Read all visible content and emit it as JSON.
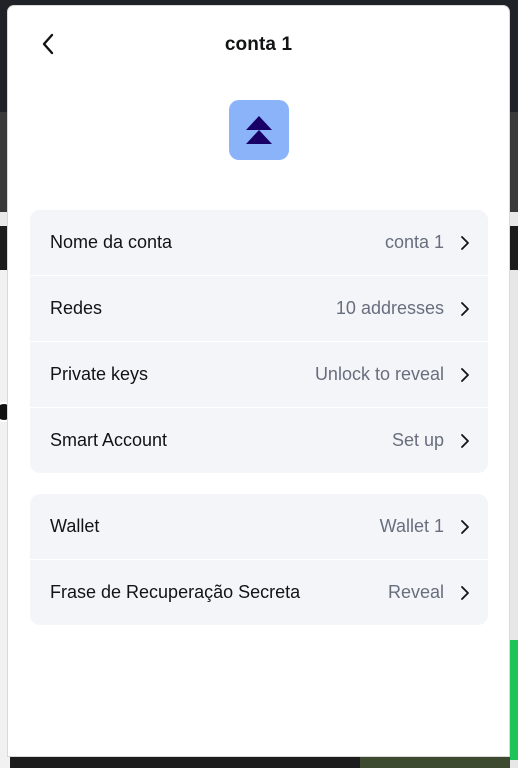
{
  "header": {
    "title": "conta 1",
    "back_icon": "chevron-left-icon"
  },
  "avatar": {
    "icon": "double-chevron-up-icon",
    "background_color": "#8ab3fa",
    "icon_color": "#190066"
  },
  "account_details": [
    {
      "label": "Nome da conta",
      "value": "conta 1"
    },
    {
      "label": "Redes",
      "value": "10 addresses"
    },
    {
      "label": "Private keys",
      "value": "Unlock to reveal"
    },
    {
      "label": "Smart Account",
      "value": "Set up"
    }
  ],
  "wallet_details": [
    {
      "label": "Wallet",
      "value": "Wallet 1"
    },
    {
      "label": "Frase de Recuperação Secreta",
      "value": "Reveal"
    }
  ],
  "colors": {
    "card_background": "#f3f5f9",
    "text_primary": "#121314",
    "text_muted": "#686e7d"
  }
}
